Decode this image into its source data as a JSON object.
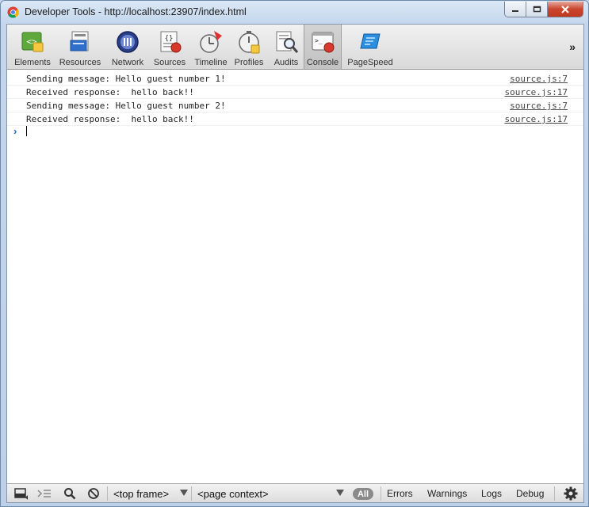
{
  "window": {
    "title": "Developer Tools - http://localhost:23907/index.html"
  },
  "toolbar": {
    "tools": [
      {
        "label": "Elements",
        "icon": "elements-icon"
      },
      {
        "label": "Resources",
        "icon": "resources-icon"
      },
      {
        "label": "Network",
        "icon": "network-icon"
      },
      {
        "label": "Sources",
        "icon": "sources-icon"
      },
      {
        "label": "Timeline",
        "icon": "timeline-icon"
      },
      {
        "label": "Profiles",
        "icon": "profiles-icon"
      },
      {
        "label": "Audits",
        "icon": "audits-icon"
      },
      {
        "label": "Console",
        "icon": "console-icon",
        "selected": true
      },
      {
        "label": "PageSpeed",
        "icon": "pagespeed-icon"
      }
    ],
    "overflow": "»"
  },
  "console": {
    "messages": [
      {
        "text": "Sending message: Hello guest number 1!",
        "source": "source.js:7"
      },
      {
        "text": "Received response:  hello back!!",
        "source": "source.js:17"
      },
      {
        "text": "Sending message: Hello guest number 2!",
        "source": "source.js:7"
      },
      {
        "text": "Received response:  hello back!!",
        "source": "source.js:17"
      }
    ],
    "prompt": "›"
  },
  "statusbar": {
    "frame_select": "<top frame>",
    "context_select": "<page context>",
    "filters": [
      "All",
      "Errors",
      "Warnings",
      "Logs",
      "Debug"
    ],
    "active_filter": "All"
  },
  "colors": {
    "selected_tab": "#c8c8c8",
    "prompt_arrow": "#2a6ad4",
    "pill": "#8a8a8a"
  }
}
